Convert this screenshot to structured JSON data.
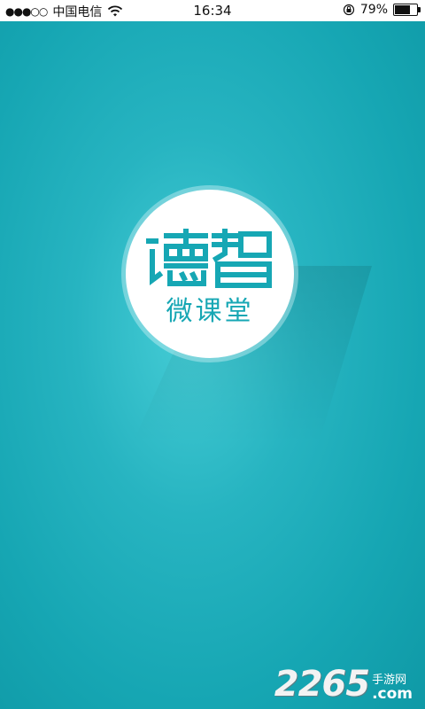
{
  "status_bar": {
    "signal": "●●●○○",
    "carrier": "中国电信",
    "time": "16:34",
    "battery_percent": "79%",
    "battery_level": 0.79
  },
  "splash": {
    "logo_text": "德智",
    "subtitle": "微课堂",
    "accent_color": "#16a7b4"
  },
  "watermark": {
    "number": "2265",
    "text": "手游网",
    "domain": ".com"
  }
}
